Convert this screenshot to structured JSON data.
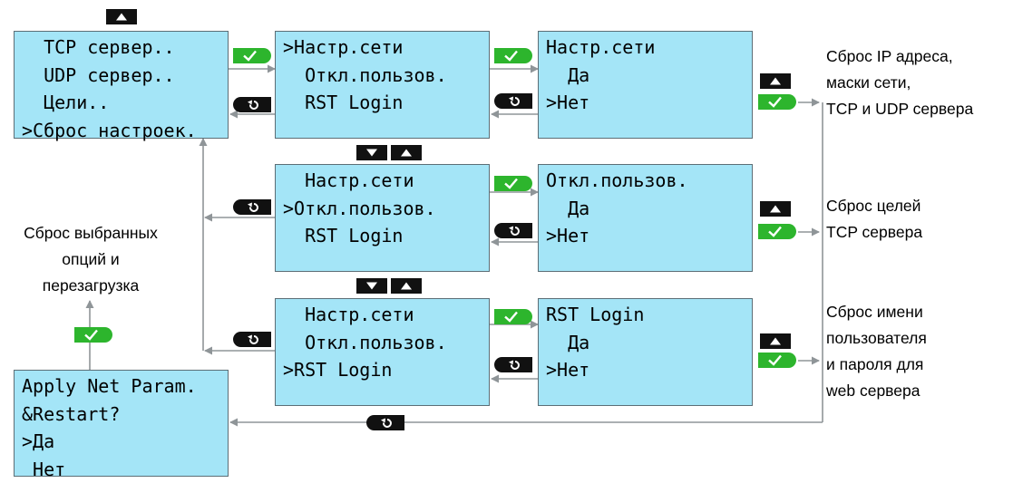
{
  "screens": {
    "main_menu": [
      "  TCP сервер..",
      "  UDP сервер..",
      "  Цели..",
      ">Сброс настроек."
    ],
    "reset_menu_1": [
      ">Настр.сети",
      "  Откл.пользов.",
      "  RST Login"
    ],
    "reset_menu_2": [
      "  Настр.сети",
      ">Откл.пользов.",
      "  RST Login"
    ],
    "reset_menu_3": [
      "  Настр.сети",
      "  Откл.пользов.",
      ">RST Login"
    ],
    "confirm_net": [
      "Настр.сети",
      "  Да",
      ">Нет"
    ],
    "confirm_users": [
      "Откл.пользов.",
      "  Да",
      ">Нет"
    ],
    "confirm_login": [
      "RST Login",
      "  Да",
      ">Нет"
    ],
    "apply_restart": [
      "Apply Net Param.",
      "&Restart?",
      ">Да",
      " Нет"
    ]
  },
  "notes": {
    "net_reset": [
      "Сброс IP адреса,",
      "маски сети,",
      "TCP и UDP сервера"
    ],
    "targets_reset": [
      "Сброс целей",
      "TCP сервера"
    ],
    "login_reset": [
      "Сброс имени",
      "пользователя",
      "и пароля для",
      "web сервера"
    ],
    "restart": [
      "Сброс выбранных",
      "опций и",
      "перезагрузка"
    ]
  },
  "icons": {
    "up": "up-arrow-key-icon",
    "down": "down-arrow-key-icon",
    "ok": "ok-checkmark-key-icon",
    "back": "back-return-key-icon"
  },
  "colors": {
    "screen_bg": "#a4e5f7",
    "ok_green": "#2db52d",
    "key_black": "#111111",
    "wire_gray": "#8f9598"
  }
}
